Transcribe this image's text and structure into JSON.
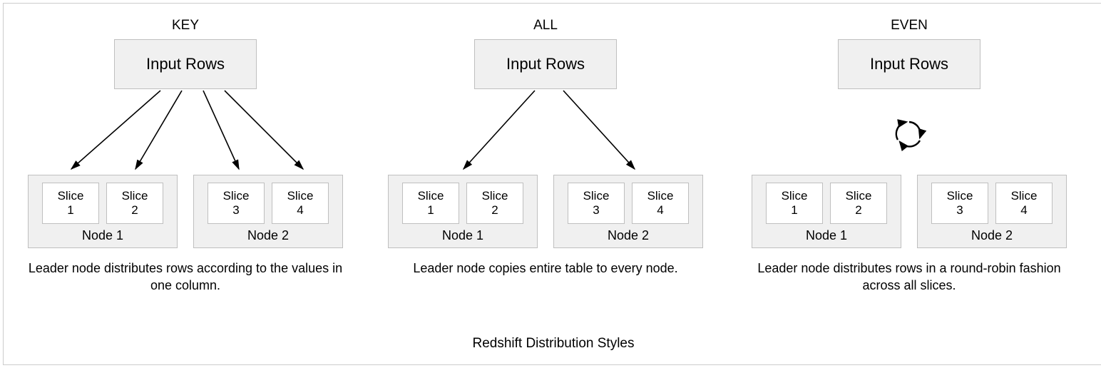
{
  "footer": "Redshift Distribution Styles",
  "panels": {
    "key": {
      "title": "KEY",
      "inputLabel": "Input Rows",
      "node1": "Node 1",
      "node2": "Node 2",
      "s1": "Slice 1",
      "s2": "Slice 2",
      "s3": "Slice 3",
      "s4": "Slice 4",
      "caption": "Leader node distributes rows according to the values in one column."
    },
    "all": {
      "title": "ALL",
      "inputLabel": "Input Rows",
      "node1": "Node 1",
      "node2": "Node 2",
      "s1": "Slice 1",
      "s2": "Slice 2",
      "s3": "Slice 3",
      "s4": "Slice 4",
      "caption": "Leader node copies entire table to every node."
    },
    "even": {
      "title": "EVEN",
      "inputLabel": "Input Rows",
      "node1": "Node 1",
      "node2": "Node 2",
      "s1": "Slice 1",
      "s2": "Slice 2",
      "s3": "Slice 3",
      "s4": "Slice 4",
      "caption": "Leader node distributes rows in a round-robin fashion across all slices."
    }
  }
}
